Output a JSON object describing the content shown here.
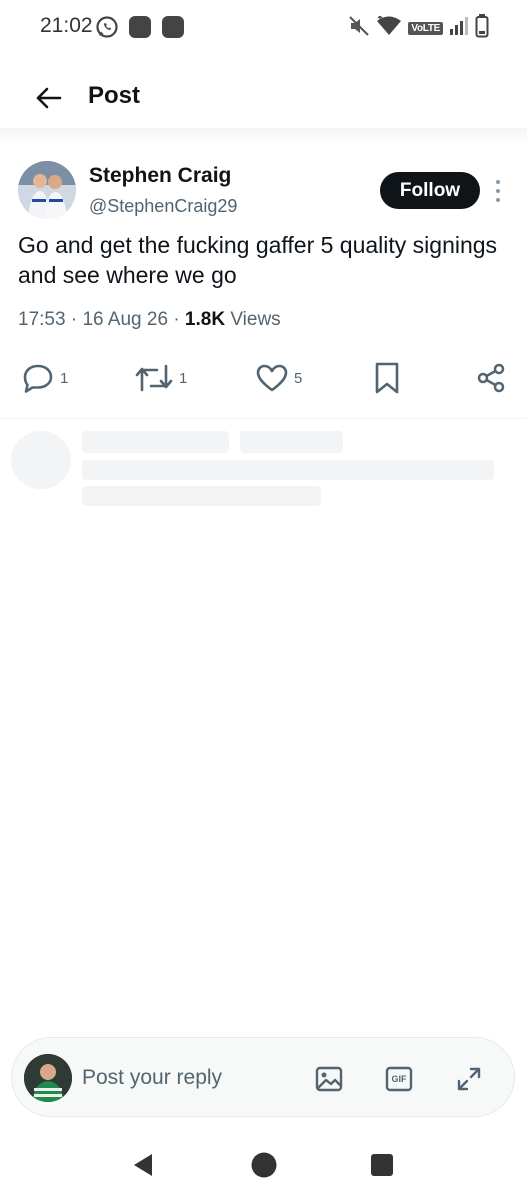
{
  "status_bar": {
    "time": "21:02",
    "left_icons": [
      "whatsapp-icon",
      "notification-icon",
      "notification-icon"
    ],
    "right_icons": [
      "mute-icon",
      "wifi-icon",
      "volte-icon",
      "signal-icon",
      "battery-icon"
    ],
    "volte_label": "VoLTE"
  },
  "header": {
    "title": "Post"
  },
  "post": {
    "author_name": "Stephen Craig",
    "author_handle": "@StephenCraig29",
    "follow_label": "Follow",
    "text": "Go and get the fucking gaffer 5 quality signings and see where we go",
    "time": "17:53",
    "date": "16 Aug 26",
    "separator": "·",
    "views_count": "1.8K",
    "views_label": "Views"
  },
  "actions": {
    "reply_count": "1",
    "repost_count": "1",
    "like_count": "5"
  },
  "reply_bar": {
    "placeholder": "Post your reply",
    "gif_label": "GIF"
  },
  "colors": {
    "text_primary": "#0f1419",
    "text_secondary": "#536471",
    "follow_bg": "#0f1419",
    "divider": "#eff3f4",
    "skeleton": "#f2f4f5"
  }
}
